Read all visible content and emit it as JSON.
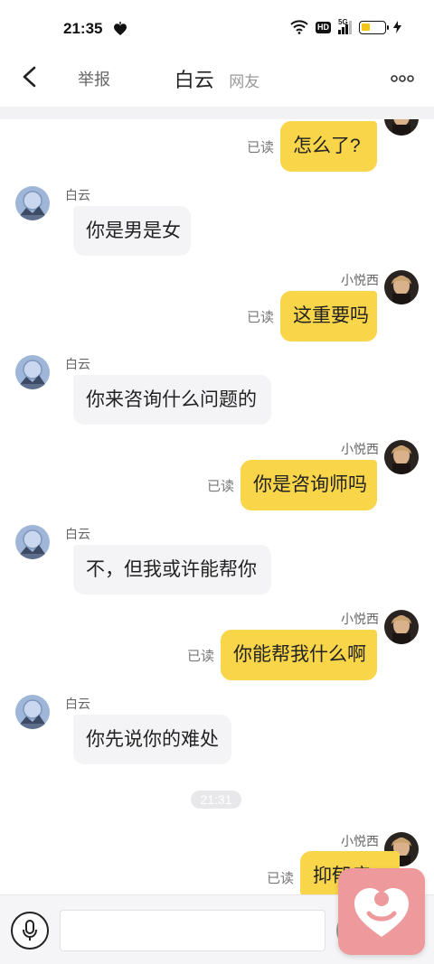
{
  "status_bar": {
    "time": "21:35",
    "network": "5G"
  },
  "header": {
    "report_label": "举报",
    "title": "白云",
    "subtitle": "网友"
  },
  "messages": [
    {
      "side": "out",
      "text": "怎么了?",
      "read": "已读",
      "sender": ""
    },
    {
      "side": "in",
      "text": "你是男是女",
      "sender": "白云"
    },
    {
      "side": "out",
      "text": "这重要吗",
      "read": "已读",
      "sender": "小悦西"
    },
    {
      "side": "in",
      "text": "你来咨询什么问题的",
      "sender": "白云"
    },
    {
      "side": "out",
      "text": "你是咨询师吗",
      "read": "已读",
      "sender": "小悦西"
    },
    {
      "side": "in",
      "text": "不，但我或许能帮你",
      "sender": "白云"
    },
    {
      "side": "out",
      "text": "你能帮我什么啊",
      "read": "已读",
      "sender": "小悦西"
    },
    {
      "side": "in",
      "text": "你先说你的难处",
      "sender": "白云"
    },
    {
      "side": "out",
      "text": "抑郁症",
      "read": "已读",
      "sender": "小悦西"
    }
  ],
  "time_divider": "21:31",
  "input": {
    "value": "",
    "placeholder": ""
  },
  "icons": {
    "back": "chevron-left-icon",
    "more": "more-dots-icon",
    "voice": "microphone-icon",
    "float": "heart-person-icon"
  },
  "colors": {
    "outgoing_bubble": "#f9d54a",
    "incoming_bubble": "#f4f4f6",
    "float_button": "#ee9a9d"
  }
}
